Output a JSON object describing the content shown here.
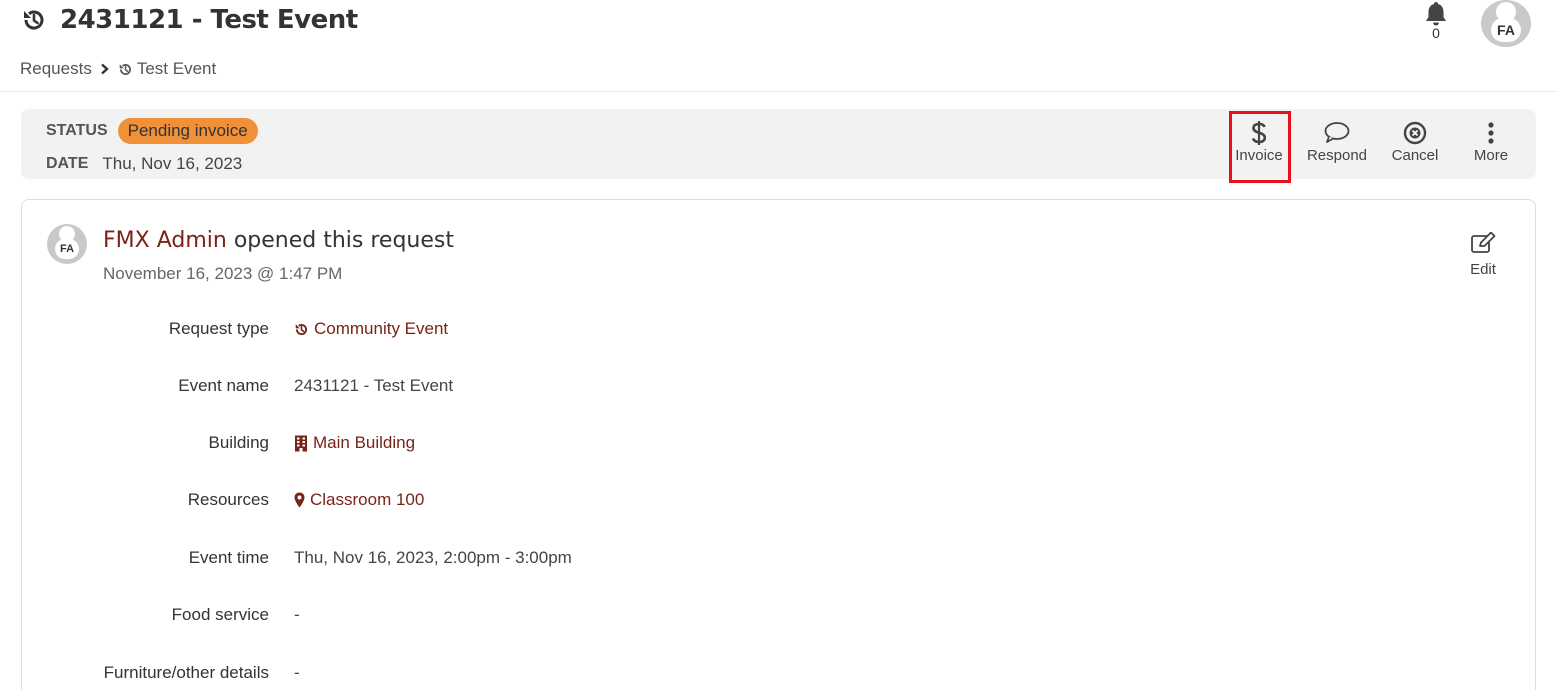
{
  "header": {
    "title": "2431121 - Test Event",
    "title_icon": "history-icon",
    "notifications_count": "0",
    "avatar_initials": "FA"
  },
  "breadcrumb": {
    "parent": "Requests",
    "current": "Test Event"
  },
  "status": {
    "status_label": "STATUS",
    "status_value": "Pending invoice",
    "status_color": "#f0913a",
    "date_label": "DATE",
    "date_value": "Thu, Nov 16, 2023"
  },
  "actions": [
    {
      "label": "Invoice",
      "icon": "dollar-icon",
      "highlighted": true
    },
    {
      "label": "Respond",
      "icon": "speech-bubble-icon"
    },
    {
      "label": "Cancel",
      "icon": "close-circle-icon"
    },
    {
      "label": "More",
      "icon": "vertical-dots-icon"
    }
  ],
  "activity": {
    "avatar_initials": "FA",
    "user_name": "FMX Admin",
    "action_text": "opened this request",
    "timestamp": "November 16, 2023 @ 1:47 PM",
    "edit_label": "Edit"
  },
  "details": [
    {
      "label": "Request type",
      "value": "Community Event",
      "icon": "history-icon",
      "link": true
    },
    {
      "label": "Event name",
      "value": "2431121 - Test Event"
    },
    {
      "label": "Building",
      "value": "Main Building",
      "icon": "building-icon",
      "link": true
    },
    {
      "label": "Resources",
      "value": "Classroom 100",
      "icon": "map-marker-icon",
      "link": true
    },
    {
      "label": "Event time",
      "value": "Thu, Nov 16, 2023, 2:00pm - 3:00pm"
    },
    {
      "label": "Food service",
      "value": "-"
    },
    {
      "label": "Furniture/other details",
      "value": "-"
    }
  ],
  "colors": {
    "accent_link": "#7a2318",
    "highlight_box": "#e8101b"
  }
}
